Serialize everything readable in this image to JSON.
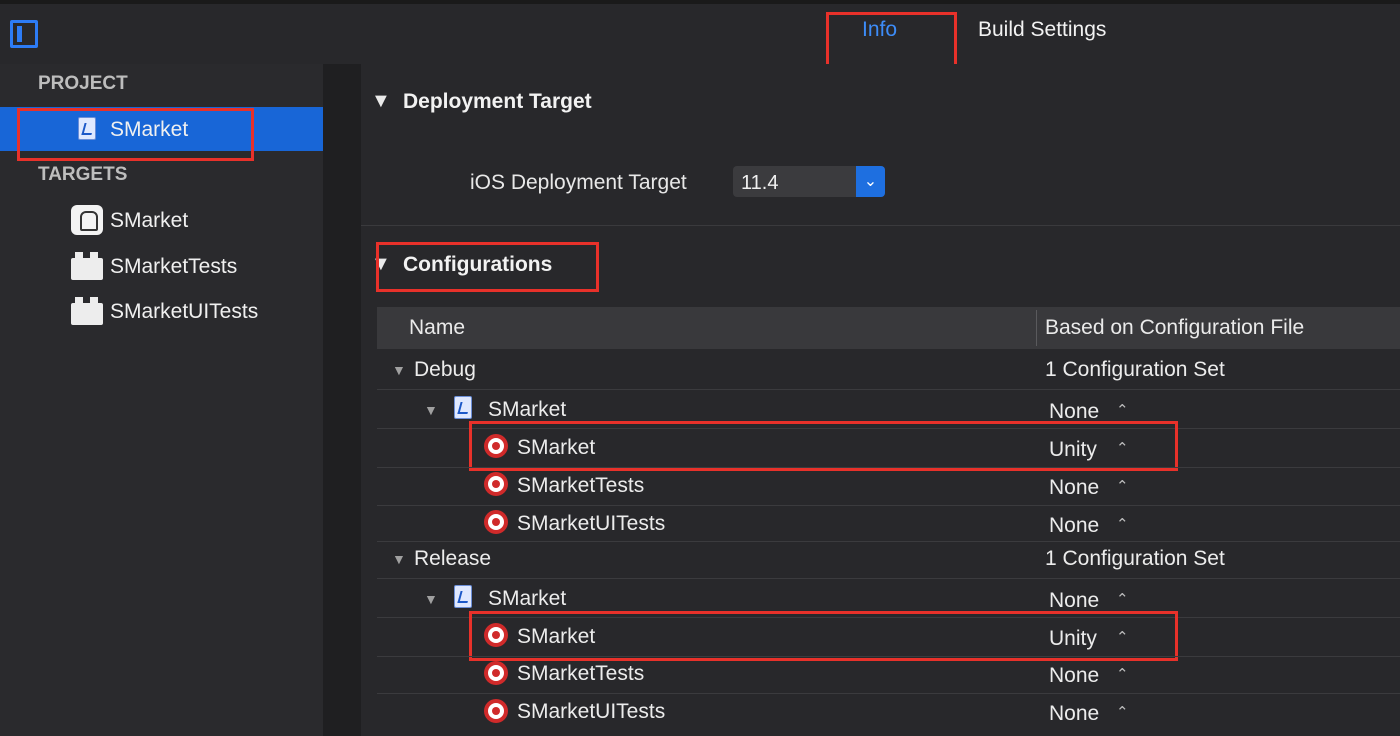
{
  "tabs": {
    "info": "Info",
    "build_settings": "Build Settings"
  },
  "sidebar": {
    "project_heading": "PROJECT",
    "project_item": "SMarket",
    "targets_heading": "TARGETS",
    "targets": [
      "SMarket",
      "SMarketTests",
      "SMarketUITests"
    ]
  },
  "deployment": {
    "section_title": "Deployment Target",
    "ios_label": "iOS Deployment Target",
    "ios_value": "11.4"
  },
  "configurations": {
    "section_title": "Configurations",
    "col_name": "Name",
    "col_file": "Based on Configuration File",
    "groups": [
      {
        "name": "Debug",
        "summary": "1 Configuration Set",
        "project": {
          "name": "SMarket",
          "value": "None"
        },
        "targets": [
          {
            "name": "SMarket",
            "value": "Unity"
          },
          {
            "name": "SMarketTests",
            "value": "None"
          },
          {
            "name": "SMarketUITests",
            "value": "None"
          }
        ]
      },
      {
        "name": "Release",
        "summary": "1 Configuration Set",
        "project": {
          "name": "SMarket",
          "value": "None"
        },
        "targets": [
          {
            "name": "SMarket",
            "value": "Unity"
          },
          {
            "name": "SMarketTests",
            "value": "None"
          },
          {
            "name": "SMarketUITests",
            "value": "None"
          }
        ]
      }
    ]
  },
  "colors": {
    "accent": "#1866d7",
    "highlight": "#e8312a",
    "tab_active": "#3d8cf7"
  }
}
